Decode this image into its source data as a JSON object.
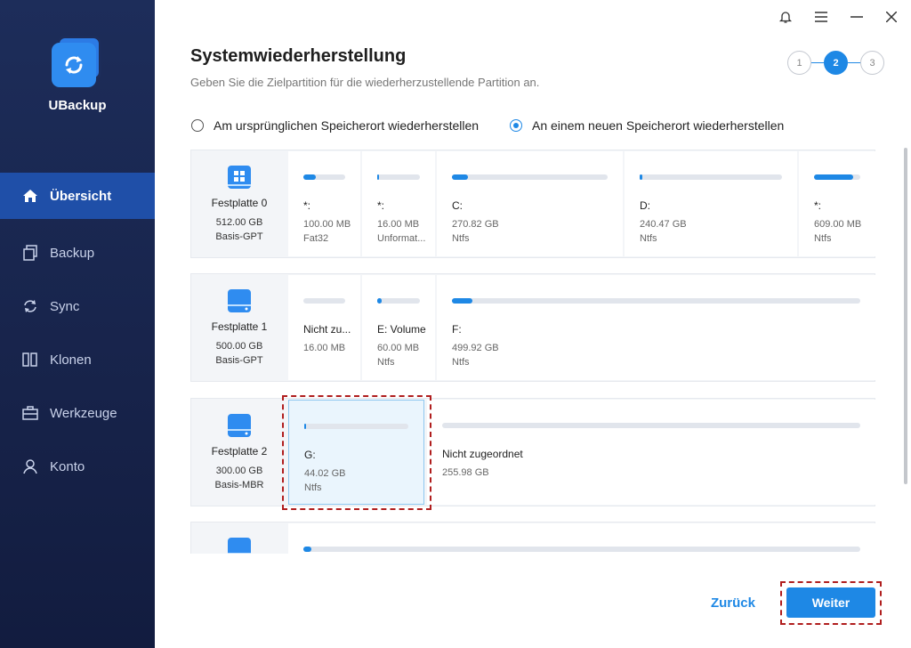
{
  "app": {
    "name": "UBackup"
  },
  "nav": [
    {
      "label": "Übersicht",
      "icon": "home-icon",
      "active": true
    },
    {
      "label": "Backup",
      "icon": "backup-icon"
    },
    {
      "label": "Sync",
      "icon": "sync-icon"
    },
    {
      "label": "Klonen",
      "icon": "clone-icon"
    },
    {
      "label": "Werkzeuge",
      "icon": "toolbox-icon"
    },
    {
      "label": "Konto",
      "icon": "user-icon"
    }
  ],
  "header": {
    "title": "Systemwiederherstellung",
    "subtitle": "Geben Sie die Zielpartition für die wiederherzustellende Partition an."
  },
  "steps": [
    "1",
    "2",
    "3"
  ],
  "options": {
    "original": "Am ursprünglichen Speicherort wiederherstellen",
    "new": "An einem neuen Speicherort wiederherstellen",
    "selected": "new"
  },
  "disks": [
    {
      "name": "Festplatte 0",
      "size": "512.00 GB",
      "type": "Basis-GPT",
      "partitions": [
        {
          "name": "*:",
          "size": "100.00 MB",
          "fs": "Fat32",
          "used": 0.3
        },
        {
          "name": "*:",
          "size": "16.00 MB",
          "fs": "Unformat...",
          "used": 0.05
        },
        {
          "name": "C:",
          "size": "270.82 GB",
          "fs": "Ntfs",
          "used": 0.1
        },
        {
          "name": "D:",
          "size": "240.47 GB",
          "fs": "Ntfs",
          "used": 0.02
        },
        {
          "name": "*:",
          "size": "609.00 MB",
          "fs": "Ntfs",
          "used": 0.85
        }
      ]
    },
    {
      "name": "Festplatte 1",
      "size": "500.00 GB",
      "type": "Basis-GPT",
      "partitions": [
        {
          "name": "Nicht zu...",
          "size": "16.00 MB",
          "fs": "",
          "used": 0
        },
        {
          "name": "E: Volume",
          "size": "60.00 MB",
          "fs": "Ntfs",
          "used": 0.1
        },
        {
          "name": "F:",
          "size": "499.92 GB",
          "fs": "Ntfs",
          "used": 0.05
        }
      ]
    },
    {
      "name": "Festplatte 2",
      "size": "300.00 GB",
      "type": "Basis-MBR",
      "partitions": [
        {
          "name": "G:",
          "size": "44.02 GB",
          "fs": "Ntfs",
          "used": 0.02,
          "selected": true
        },
        {
          "name": "Nicht zugeordnet",
          "size": "255.98 GB",
          "fs": "",
          "used": 0
        }
      ]
    },
    {
      "name": "",
      "size": "",
      "type": "",
      "partitions": [
        {
          "name": "",
          "size": "",
          "fs": "",
          "used": 0.005
        }
      ]
    }
  ],
  "buttons": {
    "back": "Zurück",
    "next": "Weiter"
  },
  "colors": {
    "accent": "#1e88e5",
    "sidebar": "#1d2d5a",
    "highlight": "#b01e1e"
  }
}
